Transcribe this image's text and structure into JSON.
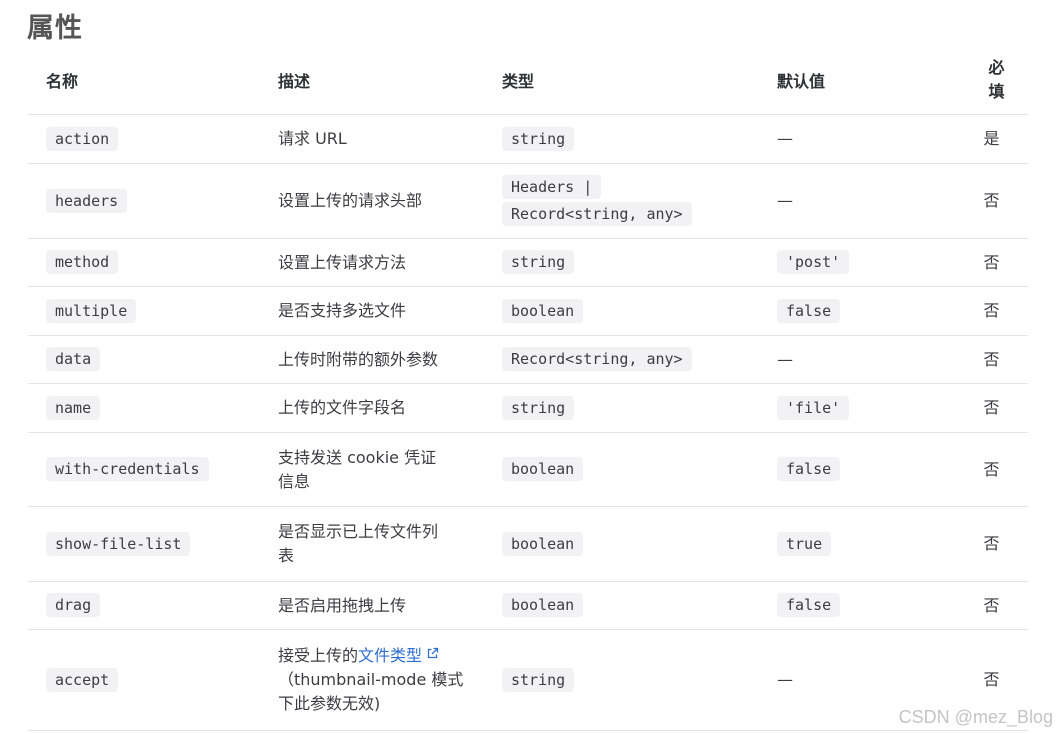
{
  "title": "属性",
  "table": {
    "headers": {
      "name": "名称",
      "description": "描述",
      "type": "类型",
      "default": "默认值",
      "required": "必填"
    },
    "rows": [
      {
        "name": "action",
        "description": "请求 URL",
        "type": "string",
        "default": "—",
        "default_is_code": false,
        "required": "是"
      },
      {
        "name": "headers",
        "description": "设置上传的请求头部",
        "type": "Headers | Record<string, any>",
        "default": "—",
        "default_is_code": false,
        "required": "否"
      },
      {
        "name": "method",
        "description": "设置上传请求方法",
        "type": "string",
        "default": "'post'",
        "default_is_code": true,
        "required": "否"
      },
      {
        "name": "multiple",
        "description": "是否支持多选文件",
        "type": "boolean",
        "default": "false",
        "default_is_code": true,
        "required": "否"
      },
      {
        "name": "data",
        "description": "上传时附带的额外参数",
        "type": "Record<string, any>",
        "default": "—",
        "default_is_code": false,
        "required": "否"
      },
      {
        "name": "name",
        "description": "上传的文件字段名",
        "type": "string",
        "default": "'file'",
        "default_is_code": true,
        "required": "否"
      },
      {
        "name": "with-credentials",
        "description": "支持发送 cookie 凭证信息",
        "type": "boolean",
        "default": "false",
        "default_is_code": true,
        "required": "否"
      },
      {
        "name": "show-file-list",
        "description": "是否显示已上传文件列表",
        "type": "boolean",
        "default": "true",
        "default_is_code": true,
        "required": "否"
      },
      {
        "name": "drag",
        "description": "是否启用拖拽上传",
        "type": "boolean",
        "default": "false",
        "default_is_code": true,
        "required": "否"
      },
      {
        "name": "accept",
        "description_prefix": "接受上传的",
        "description_link": "文件类型",
        "description_suffix": "（thumbnail-mode 模式下此参数无效)",
        "type": "string",
        "default": "—",
        "default_is_code": false,
        "required": "否"
      }
    ]
  },
  "watermark": "CSDN @mez_Blog",
  "icons": {
    "external_link": "external-link-icon"
  },
  "colors": {
    "link": "#2f6fd6",
    "code_bg": "#f2f2f4",
    "border": "#e4e4e7"
  }
}
